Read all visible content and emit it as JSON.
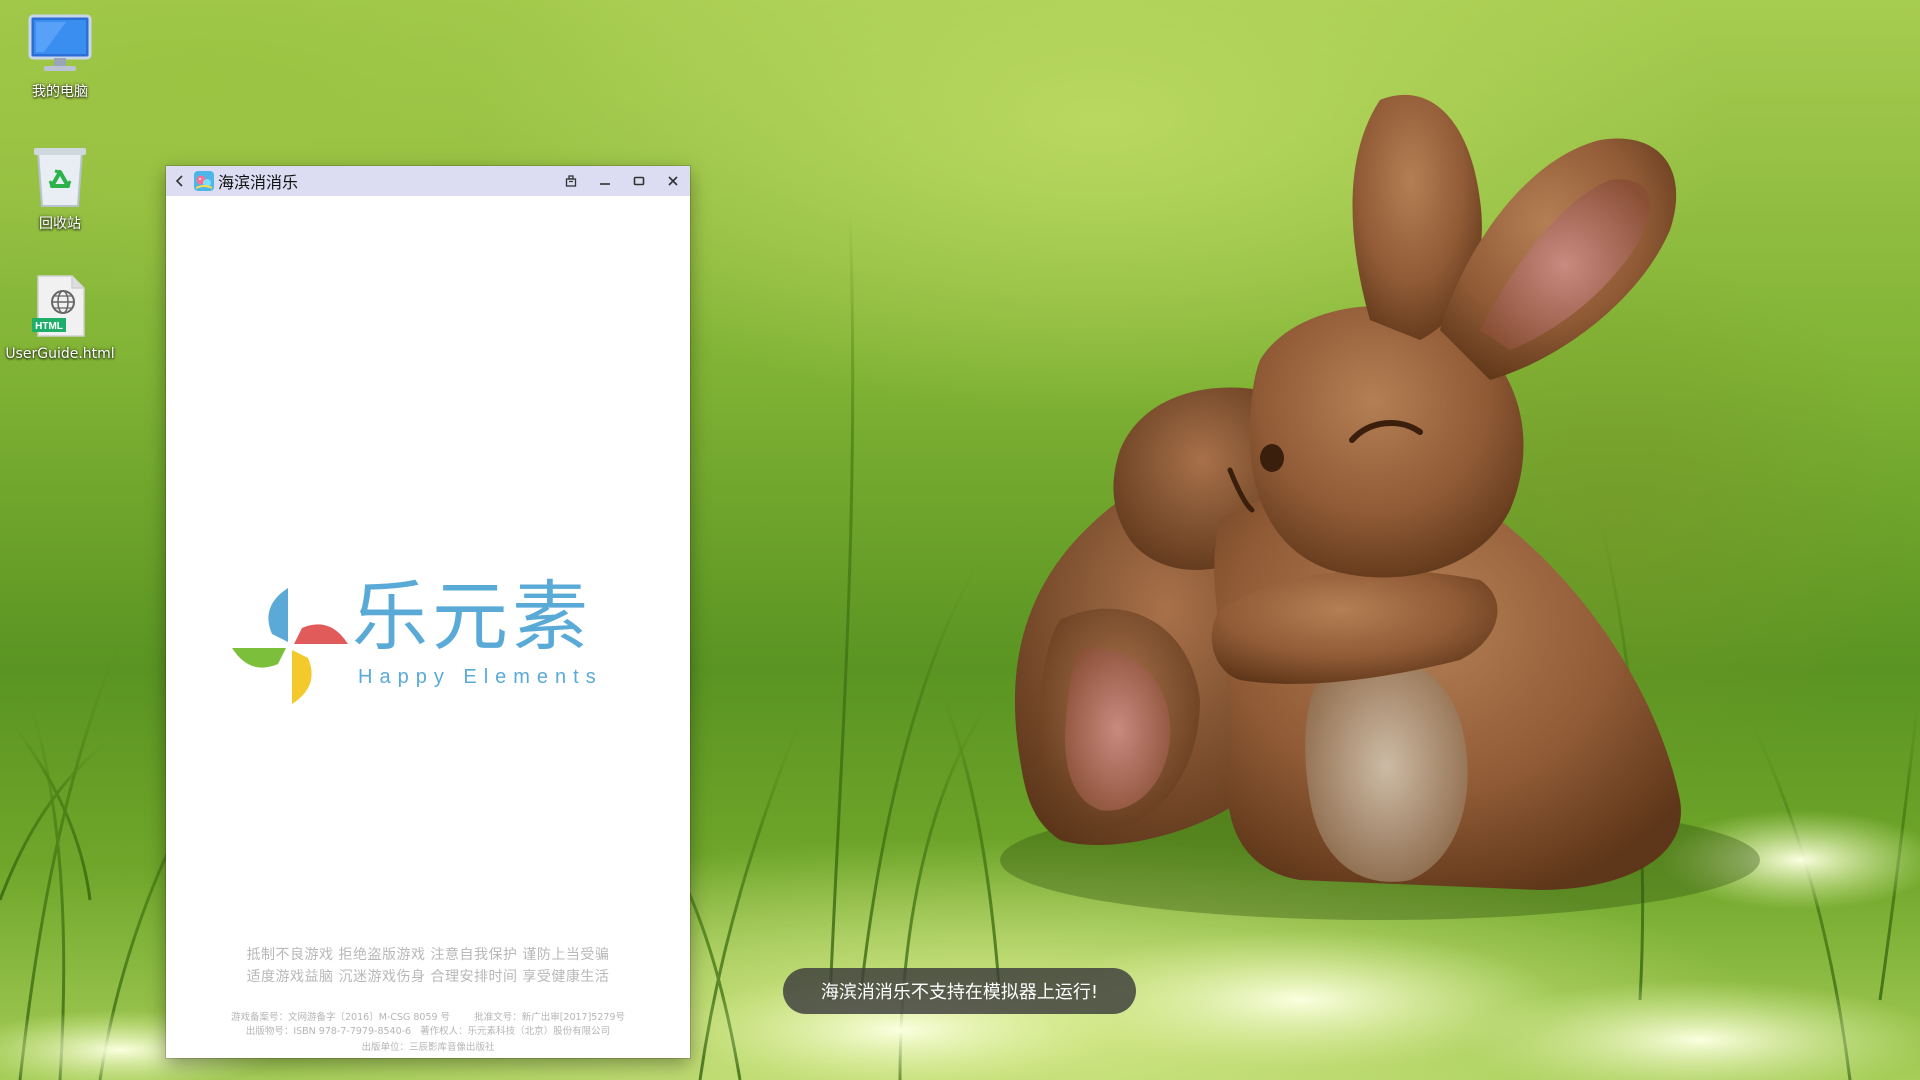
{
  "desktop": {
    "icons": [
      {
        "label": "我的电脑",
        "icon": "computer-icon"
      },
      {
        "label": "回收站",
        "icon": "recycle-bin-icon"
      },
      {
        "label": "UserGuide.html",
        "icon": "html-file-icon",
        "badge": "HTML"
      }
    ]
  },
  "window": {
    "title": "海滨消消乐",
    "icons": {
      "back": "back-arrow-icon",
      "app": "app-icon",
      "pin": "pin-window-icon",
      "minimize": "minimize-icon",
      "maximize": "maximize-icon",
      "close": "close-icon"
    },
    "splash": {
      "brand_cn": "乐元素",
      "brand_en": "Happy Elements",
      "notice_line1": "抵制不良游戏  拒绝盗版游戏  注意自我保护  谨防上当受骗",
      "notice_line2": "适度游戏益脑  沉迷游戏伤身  合理安排时间  享受健康生活",
      "fine_print": [
        "游戏备案号：文网游备字〔2016〕M-CSG 8059 号        批准文号：新广出审[2017]5279号",
        "出版物号：ISBN 978-7-7979-8540-6   著作权人：乐元素科技（北京）股份有限公司",
        "出版单位：三辰影库音像出版社"
      ]
    }
  },
  "toast": {
    "message": "海滨消消乐不支持在模拟器上运行!"
  },
  "colors": {
    "title_bar": "#dcdcf3",
    "brand_blue": "#5aaad8",
    "petal_red": "#e25b5b",
    "petal_blue": "#5aa9d6",
    "petal_green": "#7cbf3a",
    "petal_yellow": "#f3c92c"
  }
}
